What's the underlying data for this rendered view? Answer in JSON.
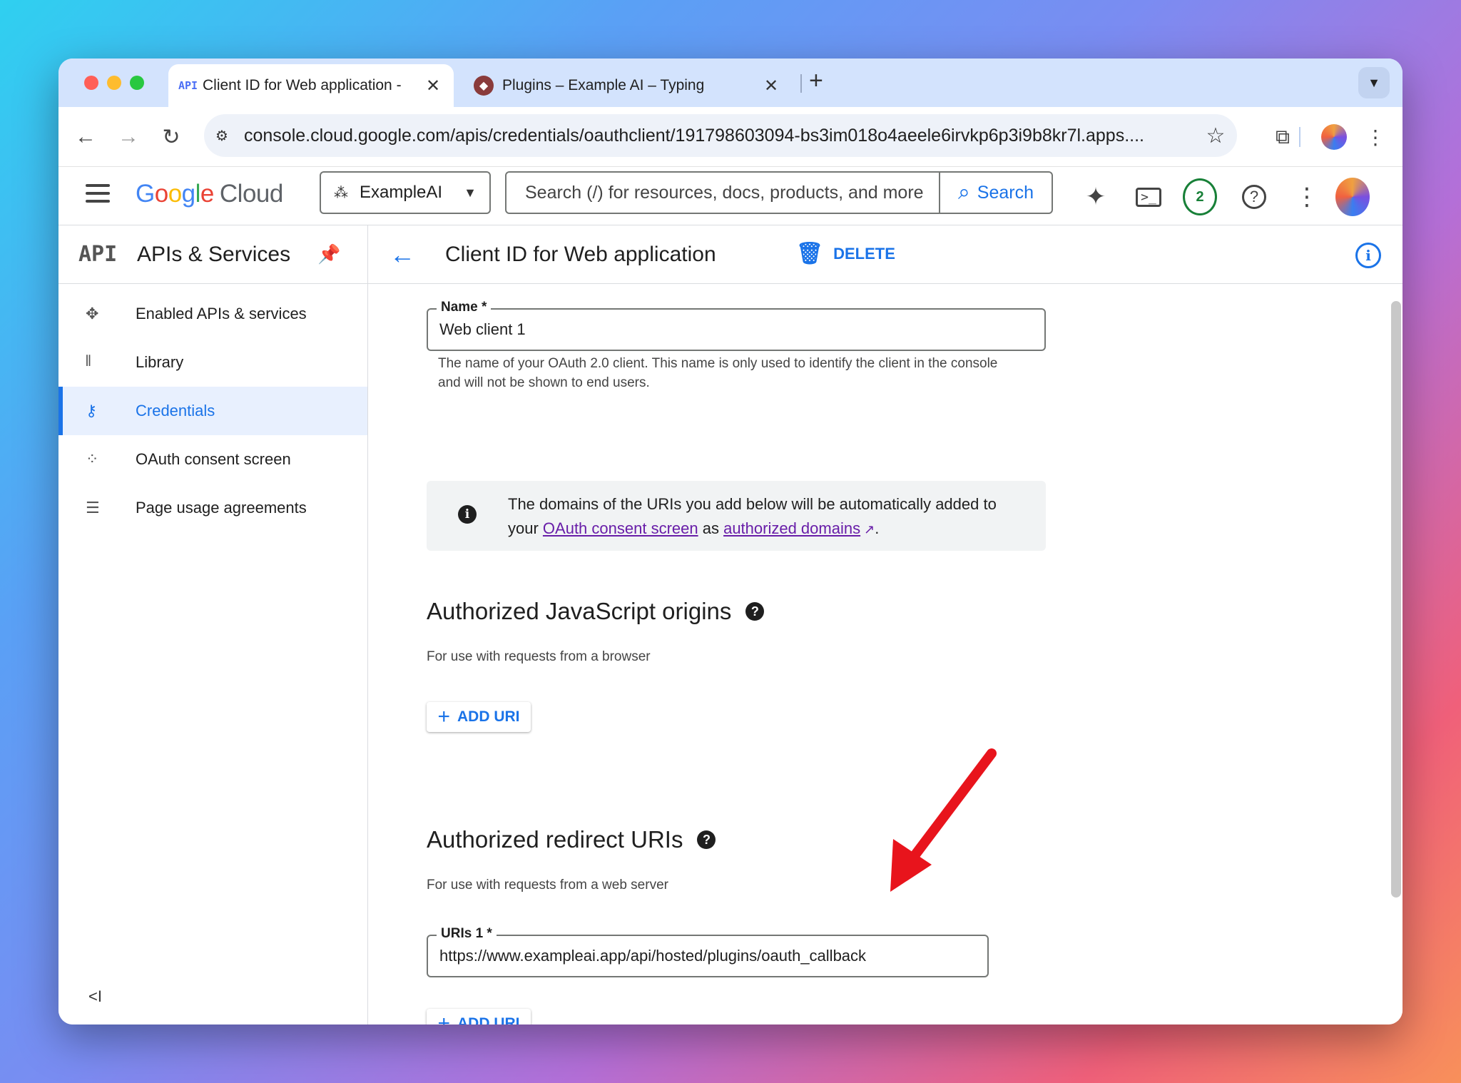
{
  "browser": {
    "tabs": [
      {
        "favicon": "API",
        "title": "Client ID for Web application - ",
        "close": "✕"
      },
      {
        "favicon": "plugin-favicon",
        "title": "Plugins – Example AI – Typing",
        "close": "✕"
      }
    ],
    "new_tab": "+",
    "url": "console.cloud.google.com/apis/credentials/oauthclient/191798603094-bs3im018o4aeele6irvkp6p3i9b8kr7l.apps...."
  },
  "header": {
    "logo": {
      "g": "G",
      "o1": "o",
      "o2": "o",
      "g2": "g",
      "l": "l",
      "e": "e",
      "cloud": "Cloud"
    },
    "project": "ExampleAI",
    "search_placeholder": "Search (/) for resources, docs, products, and more",
    "search_button": "Search",
    "notification_count": "2"
  },
  "sidebar": {
    "api_badge": "API",
    "title": "APIs & Services",
    "items": [
      {
        "label": "Enabled APIs & services",
        "icon": "apis-icon"
      },
      {
        "label": "Library",
        "icon": "library-icon"
      },
      {
        "label": "Credentials",
        "icon": "key-icon",
        "active": true
      },
      {
        "label": "OAuth consent screen",
        "icon": "consent-icon"
      },
      {
        "label": "Page usage agreements",
        "icon": "settings-list-icon"
      }
    ],
    "collapse": "<I"
  },
  "main": {
    "title": "Client ID for Web application",
    "delete_label": "DELETE",
    "name_field": {
      "label": "Name *",
      "value": "Web client 1",
      "helper": "The name of your OAuth 2.0 client. This name is only used to identify the client in the console and will not be shown to end users."
    },
    "info": {
      "line1": "The domains of the URIs you add below will be automatically added to",
      "prefix": "your ",
      "link1": "OAuth consent screen",
      "middle": " as ",
      "link2": "authorized domains",
      "suffix": "."
    },
    "js_origins": {
      "title": "Authorized JavaScript origins",
      "subtitle": "For use with requests from a browser",
      "add_label": "ADD URI"
    },
    "redirect_uris": {
      "title": "Authorized redirect URIs",
      "subtitle": "For use with requests from a web server",
      "field_label": "URIs 1 *",
      "field_value": "https://www.exampleai.app/api/hosted/plugins/oauth_callback",
      "add_label": "ADD URI"
    }
  },
  "colors": {
    "accent": "#1a73e8",
    "link_visited": "#681da8",
    "annotation_arrow": "#e8141c"
  }
}
